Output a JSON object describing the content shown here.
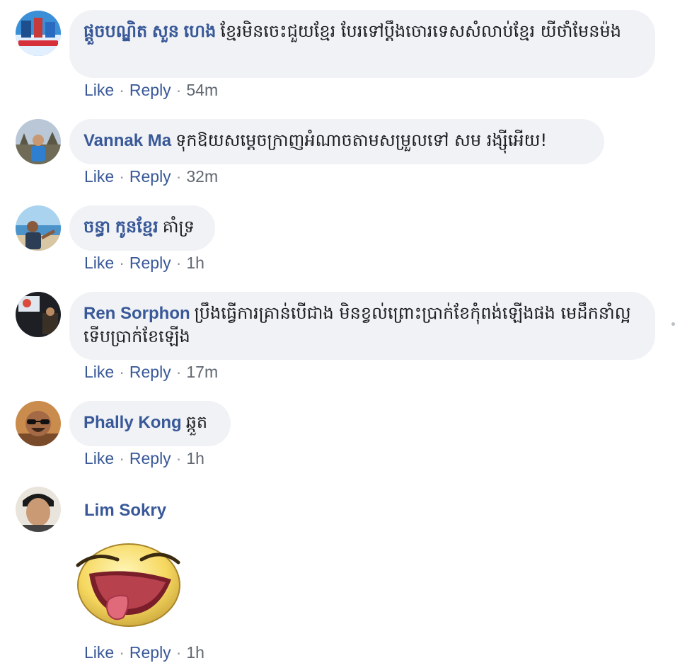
{
  "comments": [
    {
      "author": "ផ្ដួចបណ្ឌិត សួន ហេង",
      "text": "ខ្មែរមិនចេះជួយខ្មែរ បែរទៅប្ដឹងចោរទេសសំលាប់ខ្មែរ យីថាំមែនម៉ង",
      "like": "Like",
      "reply": "Reply",
      "time": "54m"
    },
    {
      "author": "Vannak Ma",
      "text": "ទុកឱយសម្ដេចក្រាញអំណាចតាមសម្រួលទៅ សម រង្ស៊ីអើយ!",
      "like": "Like",
      "reply": "Reply",
      "time": "32m"
    },
    {
      "author": "ចន្ធា កូនខ្មែរ",
      "text": "គាំទ្រ",
      "like": "Like",
      "reply": "Reply",
      "time": "1h"
    },
    {
      "author": "Ren Sorphon",
      "text": "ប្រឹងធ្វើការគ្រាន់បើជាង មិនខ្វល់ព្រោះប្រាក់ខែកុំពង់ឡើងផង មេដឹកនាំល្អទើបប្រាក់ខែឡើង",
      "like": "Like",
      "reply": "Reply",
      "time": "17m"
    },
    {
      "author": "Phally Kong",
      "text": "ឆ្កួត",
      "like": "Like",
      "reply": "Reply",
      "time": "1h"
    },
    {
      "author": "Lim Sokry",
      "text": "",
      "like": "Like",
      "reply": "Reply",
      "time": "1h"
    }
  ],
  "colors": {
    "author": "#385898",
    "bubble": "#f0f2f5",
    "meta": "#606770"
  },
  "sticker": "laughing-tongue-emoji-sticker"
}
